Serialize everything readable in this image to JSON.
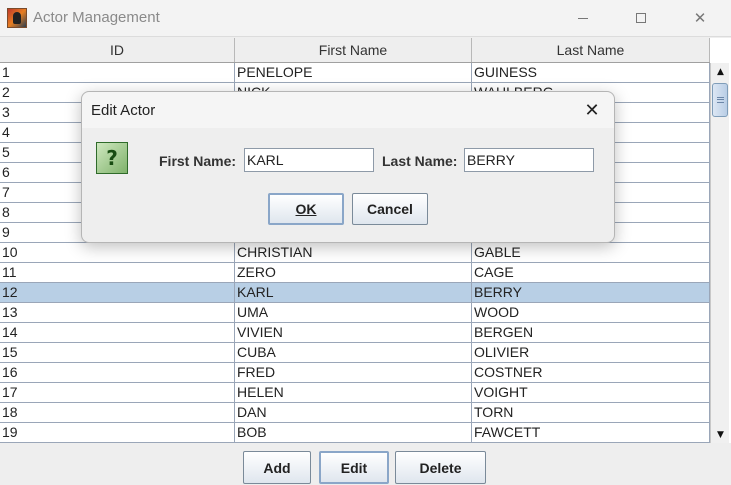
{
  "window": {
    "title": "Actor Management",
    "controls": {
      "minimize": "minimize-icon",
      "maximize": "maximize-icon",
      "close": "✕"
    }
  },
  "table": {
    "columns": [
      "ID",
      "First Name",
      "Last Name"
    ],
    "rows": [
      [
        "1",
        "PENELOPE",
        "GUINESS"
      ],
      [
        "2",
        "NICK",
        "WAHLBERG"
      ],
      [
        "3",
        "",
        ""
      ],
      [
        "4",
        "",
        ""
      ],
      [
        "5",
        "",
        ""
      ],
      [
        "6",
        "",
        ""
      ],
      [
        "7",
        "",
        ""
      ],
      [
        "8",
        "",
        ""
      ],
      [
        "9",
        "",
        ""
      ],
      [
        "10",
        "CHRISTIAN",
        "GABLE"
      ],
      [
        "11",
        "ZERO",
        "CAGE"
      ],
      [
        "12",
        "KARL",
        "BERRY"
      ],
      [
        "13",
        "UMA",
        "WOOD"
      ],
      [
        "14",
        "VIVIEN",
        "BERGEN"
      ],
      [
        "15",
        "CUBA",
        "OLIVIER"
      ],
      [
        "16",
        "FRED",
        "COSTNER"
      ],
      [
        "17",
        "HELEN",
        "VOIGHT"
      ],
      [
        "18",
        "DAN",
        "TORN"
      ],
      [
        "19",
        "BOB",
        "FAWCETT"
      ]
    ],
    "selected_row": "12"
  },
  "buttons": {
    "add": "Add",
    "edit": "Edit",
    "delete": "Delete"
  },
  "dialog": {
    "title": "Edit Actor",
    "close": "✕",
    "icon": "?",
    "first_name_label": "First Name:",
    "first_name_value": "KARL",
    "last_name_label": "Last Name:",
    "last_name_value": "BERRY",
    "ok": "OK",
    "cancel": "Cancel"
  },
  "colors": {
    "selected_row": "#b8cfe5",
    "grid": "#9aa6b8",
    "icon_green": "#7fb26b"
  }
}
